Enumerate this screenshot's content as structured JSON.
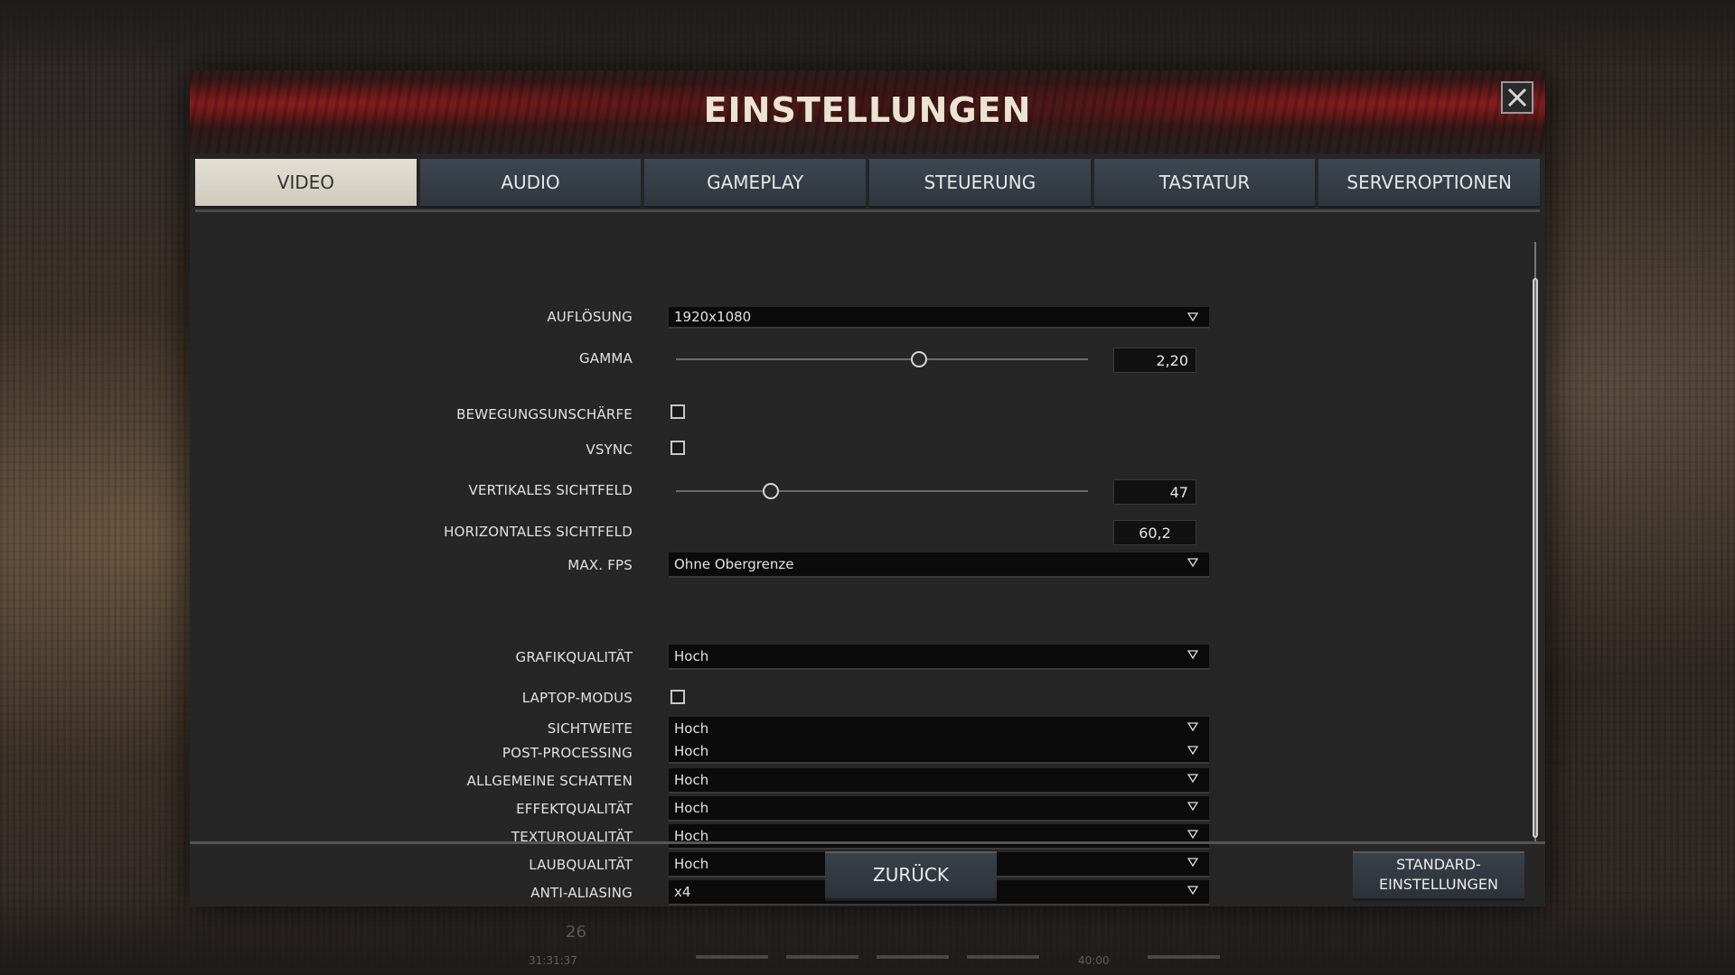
{
  "dialog": {
    "title": "EINSTELLUNGEN",
    "tabs": [
      {
        "label": "VIDEO",
        "active": true
      },
      {
        "label": "AUDIO",
        "active": false
      },
      {
        "label": "GAMEPLAY",
        "active": false
      },
      {
        "label": "STEUERUNG",
        "active": false
      },
      {
        "label": "TASTATUR",
        "active": false
      },
      {
        "label": "SERVEROPTIONEN",
        "active": false
      }
    ]
  },
  "video": {
    "aufloesung": {
      "label": "AUFLÖSUNG",
      "value": "1920x1080"
    },
    "gamma": {
      "label": "GAMMA",
      "value": "2,20",
      "slider_fraction": 0.59
    },
    "bewegungsunschaerfe": {
      "label": "BEWEGUNGSUNSCHÄRFE",
      "checked": false
    },
    "vsync": {
      "label": "VSYNC",
      "checked": false
    },
    "vertikales_sichtfeld": {
      "label": "VERTIKALES SICHTFELD",
      "value": "47",
      "slider_fraction": 0.23
    },
    "horizontales_sichtfeld": {
      "label": "HORIZONTALES SICHTFELD",
      "value": "60,2"
    },
    "max_fps": {
      "label": "MAX. FPS",
      "value": "Ohne Obergrenze"
    },
    "grafikqualitaet": {
      "label": "GRAFIKQUALITÄT",
      "value": "Hoch"
    },
    "laptop_modus": {
      "label": "LAPTOP-MODUS",
      "checked": false
    },
    "sichtweite": {
      "label": "SICHTWEITE",
      "value": "Hoch"
    },
    "post_processing": {
      "label": "POST-PROCESSING",
      "value": "Hoch"
    },
    "allgemeine_schatten": {
      "label": "ALLGEMEINE SCHATTEN",
      "value": "Hoch"
    },
    "effektqualitaet": {
      "label": "EFFEKTQUALITÄT",
      "value": "Hoch"
    },
    "texturqualitaet": {
      "label": "TEXTURQUALITÄT",
      "value": "Hoch"
    },
    "laubqualitaet": {
      "label": "LAUBQUALITÄT",
      "value": "Hoch"
    },
    "anti_aliasing": {
      "label": "ANTI-ALIASING",
      "value": "x4"
    }
  },
  "buttons": {
    "back": "ZURÜCK",
    "defaults_line1": "STANDARD-",
    "defaults_line2": "EINSTELLUNGEN"
  },
  "hud": {
    "level": "26",
    "time_left": "31:31:37",
    "time_right": "40:00"
  },
  "icons": {
    "close": "close-icon",
    "dropdown": "triangle-down-icon"
  },
  "colors": {
    "header_red": "#8a1f1f",
    "active_tab": "#e3dfd4",
    "tab": "#3d4650",
    "panel": "#262626"
  }
}
